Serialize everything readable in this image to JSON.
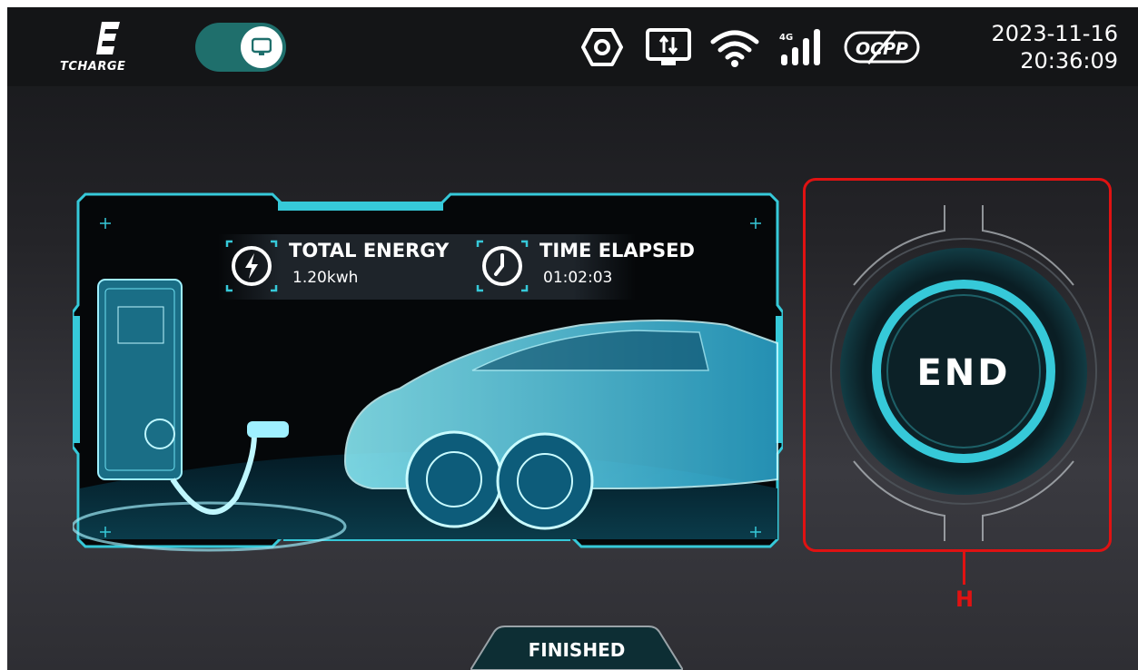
{
  "brand": {
    "name": "TCHARGE"
  },
  "header": {
    "date": "2023-11-16",
    "time": "20:36:09",
    "toggle": {
      "state": "on",
      "icon": "monitor-icon"
    },
    "status_icons": [
      "settings-hex-icon",
      "data-transfer-icon",
      "wifi-icon",
      "cellular-4g-icon",
      "ocpp-disabled-icon"
    ],
    "network_label": "4G",
    "ocpp_label": "OCPP"
  },
  "session": {
    "energy_label": "TOTAL ENERGY",
    "energy_value": "1.20kwh",
    "time_label": "TIME ELAPSED",
    "time_value": "01:02:03"
  },
  "end_button": {
    "label": "END"
  },
  "annotation": {
    "label": "H"
  },
  "status": {
    "label": "FINISHED"
  },
  "colors": {
    "accent": "#36c9d9",
    "toggle": "#1f6f6c",
    "highlight": "#e01212"
  }
}
